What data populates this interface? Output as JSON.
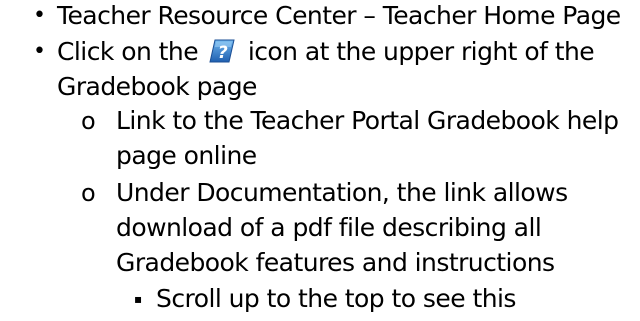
{
  "bullets": {
    "level1": "•",
    "level2": "o",
    "level3": "▪"
  },
  "items": [
    {
      "text": "Teacher Resource Center – Teacher Home Page"
    },
    {
      "text_before_icon": "Click on the",
      "icon": "help-icon",
      "text_after_icon": "icon at the upper right of the",
      "continuation": "Gradebook page"
    },
    {
      "line1": "Link to the Teacher Portal Gradebook help",
      "line2": "page online"
    },
    {
      "line1": "Under Documentation, the link allows",
      "line2": "download of a pdf file describing all",
      "line3": "Gradebook features and instructions"
    },
    {
      "text": "Scroll up to the top to see this"
    }
  ],
  "colors": {
    "text": "#000000",
    "icon_blue": "#1f6fbf",
    "icon_blue_light": "#5aa6e6",
    "icon_mark": "#ffffff"
  }
}
